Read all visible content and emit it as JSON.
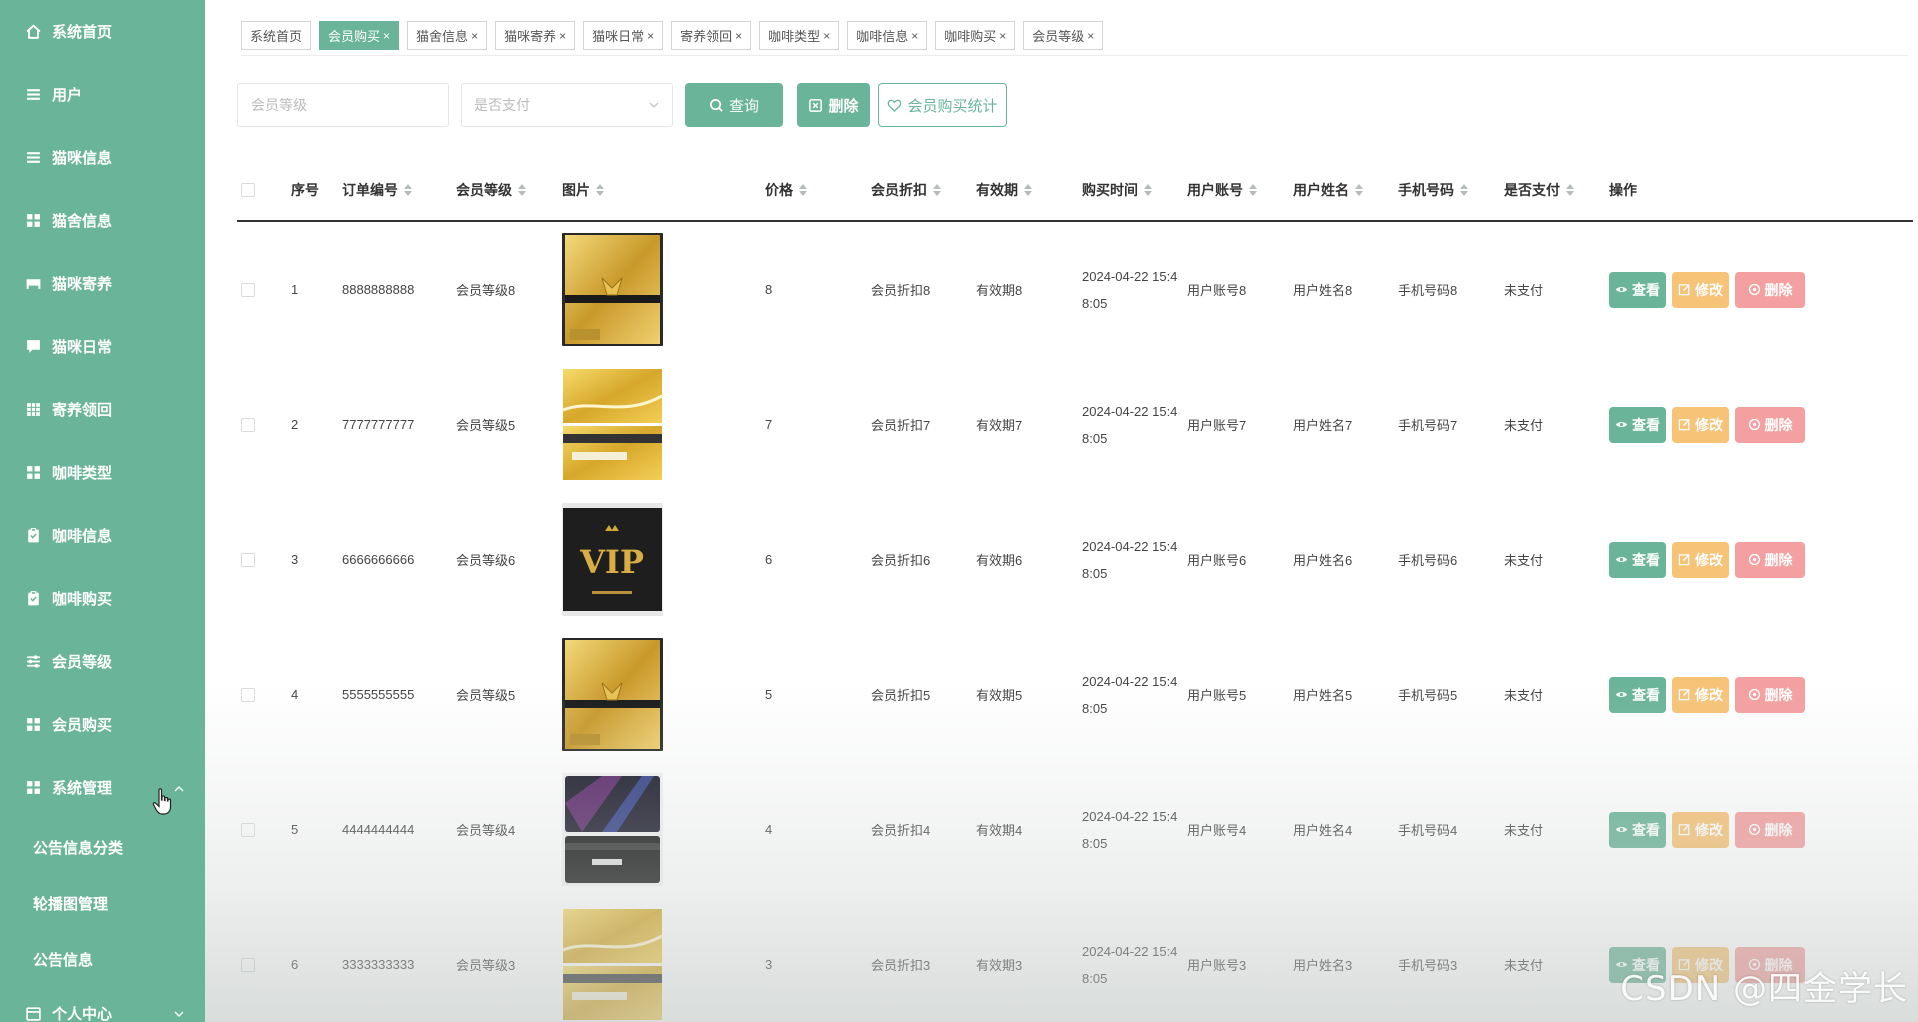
{
  "sidebar": {
    "items": [
      {
        "label": "系统首页",
        "icon": "home-icon"
      },
      {
        "label": "用户",
        "icon": "list-icon"
      },
      {
        "label": "猫咪信息",
        "icon": "list-icon"
      },
      {
        "label": "猫舍信息",
        "icon": "grid-icon"
      },
      {
        "label": "猫咪寄养",
        "icon": "bed-icon"
      },
      {
        "label": "猫咪日常",
        "icon": "chat-icon"
      },
      {
        "label": "寄养领回",
        "icon": "table-icon"
      },
      {
        "label": "咖啡类型",
        "icon": "grid-icon"
      },
      {
        "label": "咖啡信息",
        "icon": "clipboard-icon"
      },
      {
        "label": "咖啡购买",
        "icon": "clipboard-icon"
      },
      {
        "label": "会员等级",
        "icon": "sliders-icon"
      },
      {
        "label": "会员购买",
        "icon": "grid-icon"
      }
    ],
    "system": {
      "label": "系统管理",
      "children": [
        "公告信息分类",
        "轮播图管理",
        "公告信息"
      ]
    },
    "personal": {
      "label": "个人中心"
    }
  },
  "tags": [
    {
      "label": "系统首页",
      "closable": false,
      "active": false
    },
    {
      "label": "会员购买",
      "closable": true,
      "active": true
    },
    {
      "label": "猫舍信息",
      "closable": true,
      "active": false
    },
    {
      "label": "猫咪寄养",
      "closable": true,
      "active": false
    },
    {
      "label": "猫咪日常",
      "closable": true,
      "active": false
    },
    {
      "label": "寄养领回",
      "closable": true,
      "active": false
    },
    {
      "label": "咖啡类型",
      "closable": true,
      "active": false
    },
    {
      "label": "咖啡信息",
      "closable": true,
      "active": false
    },
    {
      "label": "咖啡购买",
      "closable": true,
      "active": false
    },
    {
      "label": "会员等级",
      "closable": true,
      "active": false
    }
  ],
  "search": {
    "level_placeholder": "会员等级",
    "paid_placeholder": "是否支付",
    "query_label": "查询",
    "delete_label": "删除",
    "stats_label": "会员购买统计"
  },
  "table": {
    "headers": [
      "序号",
      "订单编号",
      "会员等级",
      "图片",
      "价格",
      "会员折扣",
      "有效期",
      "购买时间",
      "用户账号",
      "用户姓名",
      "手机号码",
      "是否支付",
      "操作"
    ],
    "sortable": [
      false,
      true,
      true,
      true,
      true,
      true,
      true,
      true,
      true,
      true,
      true,
      true,
      false
    ],
    "rows": [
      {
        "idx": "1",
        "order": "8888888888",
        "level": "会员等级8",
        "image": "gold-club-card",
        "price": "8",
        "discount": "会员折扣8",
        "validity": "有效期8",
        "time1": "2024-04-22 15:4",
        "time2": "8:05",
        "account": "用户账号8",
        "name": "用户姓名8",
        "phone": "手机号码8",
        "paid": "未支付"
      },
      {
        "idx": "2",
        "order": "7777777777",
        "level": "会员等级5",
        "image": "gold-sparkle-card",
        "price": "7",
        "discount": "会员折扣7",
        "validity": "有效期7",
        "time1": "2024-04-22 15:4",
        "time2": "8:05",
        "account": "用户账号7",
        "name": "用户姓名7",
        "phone": "手机号码7",
        "paid": "未支付"
      },
      {
        "idx": "3",
        "order": "6666666666",
        "level": "会员等级6",
        "image": "black-vip-card",
        "price": "6",
        "discount": "会员折扣6",
        "validity": "有效期6",
        "time1": "2024-04-22 15:4",
        "time2": "8:05",
        "account": "用户账号6",
        "name": "用户姓名6",
        "phone": "手机号码6",
        "paid": "未支付"
      },
      {
        "idx": "4",
        "order": "5555555555",
        "level": "会员等级5",
        "image": "gold-club-card",
        "price": "5",
        "discount": "会员折扣5",
        "validity": "有效期5",
        "time1": "2024-04-22 15:4",
        "time2": "8:05",
        "account": "用户账号5",
        "name": "用户姓名5",
        "phone": "手机号码5",
        "paid": "未支付"
      },
      {
        "idx": "5",
        "order": "4444444444",
        "level": "会员等级4",
        "image": "dark-purple-card",
        "price": "4",
        "discount": "会员折扣4",
        "validity": "有效期4",
        "time1": "2024-04-22 15:4",
        "time2": "8:05",
        "account": "用户账号4",
        "name": "用户姓名4",
        "phone": "手机号码4",
        "paid": "未支付"
      },
      {
        "idx": "6",
        "order": "3333333333",
        "level": "会员等级3",
        "image": "gold-sparkle-card",
        "price": "3",
        "discount": "会员折扣3",
        "validity": "有效期3",
        "time1": "2024-04-22 15:4",
        "time2": "8:05",
        "account": "用户账号3",
        "name": "用户姓名3",
        "phone": "手机号码3",
        "paid": "未支付"
      }
    ],
    "ops": {
      "view": "查看",
      "edit": "修改",
      "delete": "删除"
    }
  },
  "watermark": "CSDN @四金学长",
  "colors": {
    "primary": "#6ab499",
    "edit": "#f7c377",
    "delete": "#f4a0a0"
  }
}
